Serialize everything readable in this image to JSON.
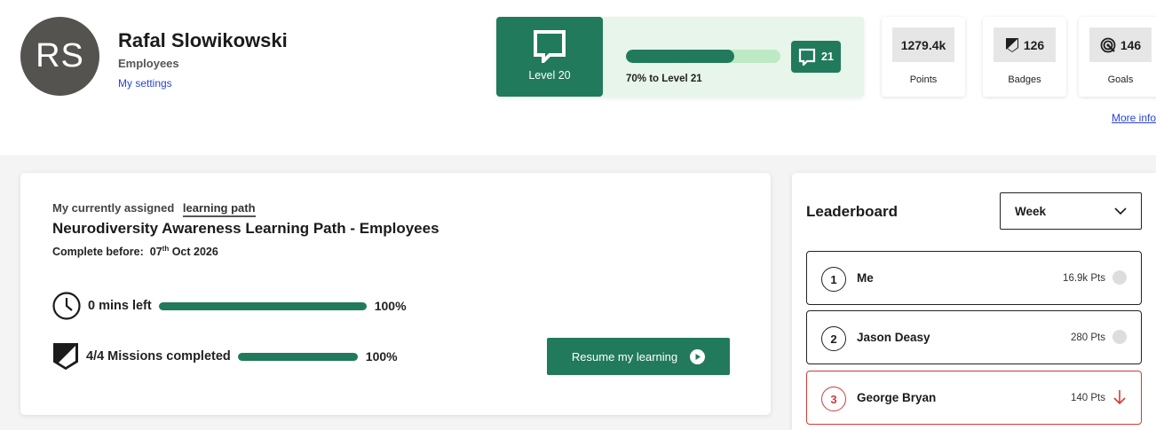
{
  "profile": {
    "initials": "RS",
    "name": "Rafal Slowikowski",
    "role": "Employees",
    "settings_link": "My settings"
  },
  "level": {
    "current_label": "Level 20",
    "progress_percent": 70,
    "progress_text": "70% to Level 21",
    "next_level_number": "21"
  },
  "stats": [
    {
      "value": "1279.4k",
      "label": "Points",
      "icon": ""
    },
    {
      "value": "126",
      "label": "Badges",
      "icon": "shield-icon"
    },
    {
      "value": "146",
      "label": "Goals",
      "icon": "target-icon"
    }
  ],
  "more_info": "More info",
  "learning_path": {
    "assigned_prefix": "My currently assigned",
    "assigned_link": "learning path",
    "title": "Neurodiversity Awareness Learning Path - Employees",
    "due_label": "Complete before:",
    "due_day": "07",
    "due_suffix": "th",
    "due_rest": "Oct 2026",
    "time_row": {
      "label": "0 mins left",
      "percent": 100,
      "percent_text": "100%"
    },
    "missions_row": {
      "label": "4/4 Missions completed",
      "percent": 100,
      "percent_text": "100%"
    },
    "resume_button": "Resume my learning"
  },
  "leaderboard": {
    "title": "Leaderboard",
    "period": "Week",
    "rows": [
      {
        "rank": "1",
        "name": "Me",
        "points": "16.9k Pts",
        "trend": "same"
      },
      {
        "rank": "2",
        "name": "Jason Deasy",
        "points": "280 Pts",
        "trend": "same"
      },
      {
        "rank": "3",
        "name": "George Bryan",
        "points": "140 Pts",
        "trend": "down"
      }
    ]
  },
  "colors": {
    "brand_green": "#217a5b",
    "light_green": "#bde9c4",
    "link_blue": "#2a44d6",
    "down_red": "#d23b3b"
  }
}
